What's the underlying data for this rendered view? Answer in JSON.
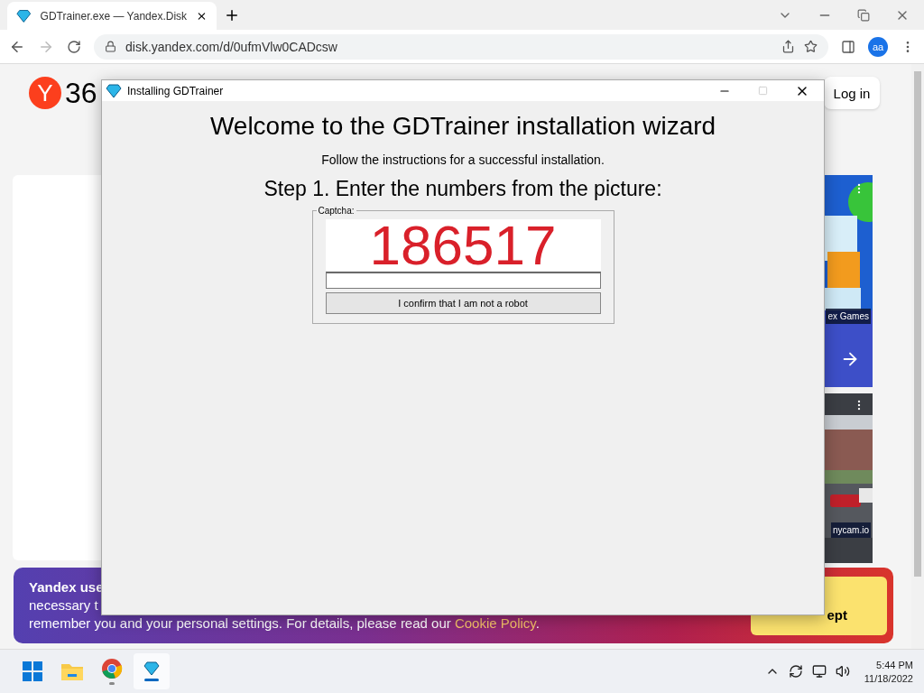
{
  "browser": {
    "tab": {
      "title": "GDTrainer.exe — Yandex.Disk"
    },
    "address": "disk.yandex.com/d/0ufmVlw0CADcsw",
    "profile": "aa"
  },
  "page": {
    "logo_mark": "Y",
    "logo_text": "36",
    "login": "Log in",
    "ads": [
      {
        "kind": "game",
        "caption": "ex Games"
      },
      {
        "kind": "video",
        "caption": "nycam.io"
      }
    ]
  },
  "cookie_banner": {
    "title": "Yandex use",
    "line": "necessary t",
    "sentence": "remember you and your personal settings. For details, please read our ",
    "link": "Cookie Policy",
    "end": ".",
    "accept": "ept"
  },
  "dialog": {
    "title": "Installing GDTrainer",
    "heading": "Welcome to the GDTrainer installation wizard",
    "subtitle": "Follow the instructions for a successful installation.",
    "step": "Step 1. Enter the numbers from the picture:",
    "group_label": "Captcha:",
    "captcha": "186517",
    "confirm": "I confirm that I am not a robot"
  },
  "taskbar": {
    "apps": [
      {
        "kind": "start",
        "running": false,
        "selected": false
      },
      {
        "kind": "explorer",
        "running": false,
        "selected": false
      },
      {
        "kind": "chrome",
        "running": true,
        "selected": false
      },
      {
        "kind": "gem",
        "running": true,
        "selected": true
      }
    ],
    "time": "5:44 PM",
    "date": "11/18/2022"
  }
}
